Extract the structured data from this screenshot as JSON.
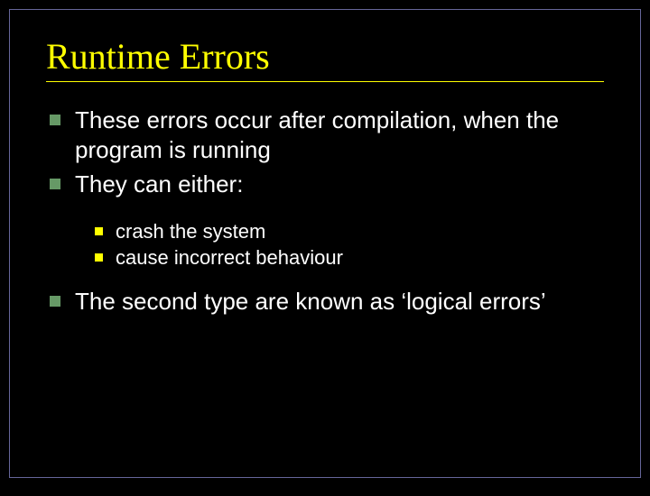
{
  "title": "Runtime Errors",
  "bullets": {
    "item1": "These errors occur after compilation, when the program is running",
    "item2": "They can either:",
    "sub1": "crash the system",
    "sub2": "cause incorrect behaviour",
    "item3": "The second type are known as ‘logical errors’"
  }
}
